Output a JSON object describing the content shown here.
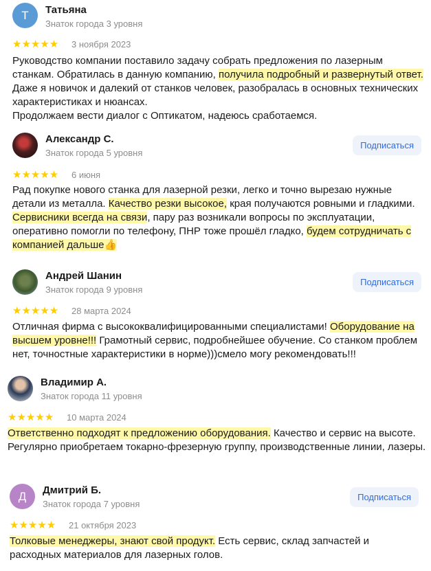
{
  "reviews": [
    {
      "name": "Татьяна",
      "avatar_letter": "Т",
      "level": "Знаток города 3 уровня",
      "stars": "★★★★★",
      "rating": 5,
      "date": "3 ноября 2023",
      "subscribe_label": "",
      "text": {
        "p1": "Руководство компании поставило задачу собрать предложения по лазерным станкам. Обратилась в данную компанию, ",
        "h1": "получила подробный и развернутый ответ.",
        "p2": " Даже я новичок и далекий от станков человек, разобралась в основных технических характеристиках и нюансах.",
        "p3": "Продолжаем вести диалог с Оптикатом, надеюсь сработаемся."
      }
    },
    {
      "name": "Александр С.",
      "avatar_letter": "",
      "level": "Знаток города 5 уровня",
      "stars": "★★★★★",
      "rating": 5,
      "date": "6 июня",
      "subscribe_label": "Подписаться",
      "text": {
        "p1": "Рад покупке нового станка для лазерной резки, легко и точно вырезаю нужные детали из металла. ",
        "h1": "Качество резки высокое,",
        "p2": " края получаются ровными и гладкими. ",
        "h2": "Сервисники всегда на связи",
        "p3": ", пару раз возникали вопросы по эксплуатации, оперативно помогли по телефону, ПНР тоже прошёл гладко, ",
        "h3": "будем сотрудничать с компанией дальше👍"
      }
    },
    {
      "name": "Андрей Шанин",
      "avatar_letter": "",
      "level": "Знаток города 9 уровня",
      "stars": "★★★★★",
      "rating": 5,
      "date": "28 марта 2024",
      "subscribe_label": "Подписаться",
      "text": {
        "p1": "Отличная фирма с высококвалифицированными специалистами! ",
        "h1": "Оборудование на высшем уровне!!!",
        "p2": " Грамотный сервис, подробнейшее обучение. Со станком проблем нет, точностные характеристики в норме)))смело могу рекомендовать!!!"
      }
    },
    {
      "name": "Владимир А.",
      "avatar_letter": "",
      "level": "Знаток города 11 уровня",
      "stars": "★★★★★",
      "rating": 5,
      "date": "10 марта 2024",
      "subscribe_label": "",
      "text": {
        "h1": "Ответственно подходят к предложению оборудования.",
        "p1": " Качество и сервис на высоте. Регулярно приобретаем токарно-фрезерную группу, производственные линии, лазеры."
      }
    },
    {
      "name": "Дмитрий Б.",
      "avatar_letter": "Д",
      "level": "Знаток города 7 уровня",
      "stars": "★★★★★",
      "rating": 5,
      "date": "21 октября 2023",
      "subscribe_label": "Подписаться",
      "text": {
        "h1": "Толковые менеджеры, знают свой продукт.",
        "p1": " Есть сервис, склад запчастей и расходных материалов для лазерных голов."
      }
    }
  ]
}
